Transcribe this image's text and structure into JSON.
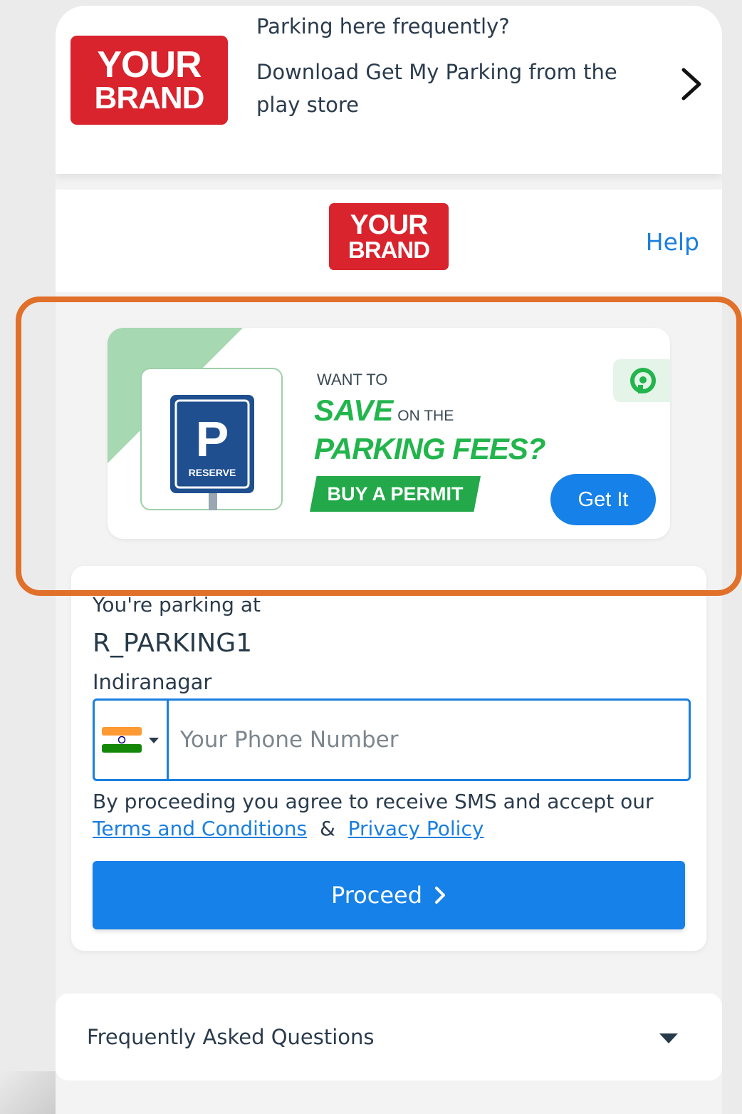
{
  "app_banner": {
    "logo_line1": "YOUR",
    "logo_line2": "BRAND",
    "question": "Parking here frequently?",
    "body": "Download Get My Parking from the play store"
  },
  "header": {
    "logo_line1": "YOUR",
    "logo_line2": "BRAND",
    "help_label": "Help"
  },
  "promo": {
    "sign_letter": "P",
    "sign_label": "RESERVE",
    "want_to": "WANT TO",
    "save": "SAVE",
    "on_the": "ON THE",
    "fees": "PARKING FEES?",
    "permit": "BUY A PERMIT",
    "cta_label": "Get It"
  },
  "form": {
    "parking_at_label": "You're parking at",
    "parking_name": "R_PARKING1",
    "parking_area": "Indiranagar",
    "phone_placeholder": "Your Phone Number",
    "phone_value": "",
    "consent_prefix": "By proceeding you agree to receive SMS and accept our",
    "terms_link": "Terms and Conditions",
    "consent_and": "&",
    "privacy_link": "Privacy Policy",
    "proceed_label": "Proceed"
  },
  "faq": {
    "title": "Frequently Asked Questions"
  },
  "colors": {
    "brand_red": "#d9232d",
    "primary_blue": "#1681e8",
    "promo_green": "#22b54c",
    "highlight_orange": "#e0702a"
  },
  "icons": {
    "banner_chevron": "chevron-right-icon",
    "country_flag": "india-flag-icon",
    "country_caret": "caret-down-icon",
    "proceed_chevron": "chevron-right-icon",
    "faq_caret": "caret-down-icon",
    "promo_brand": "gmp-logo-icon"
  }
}
